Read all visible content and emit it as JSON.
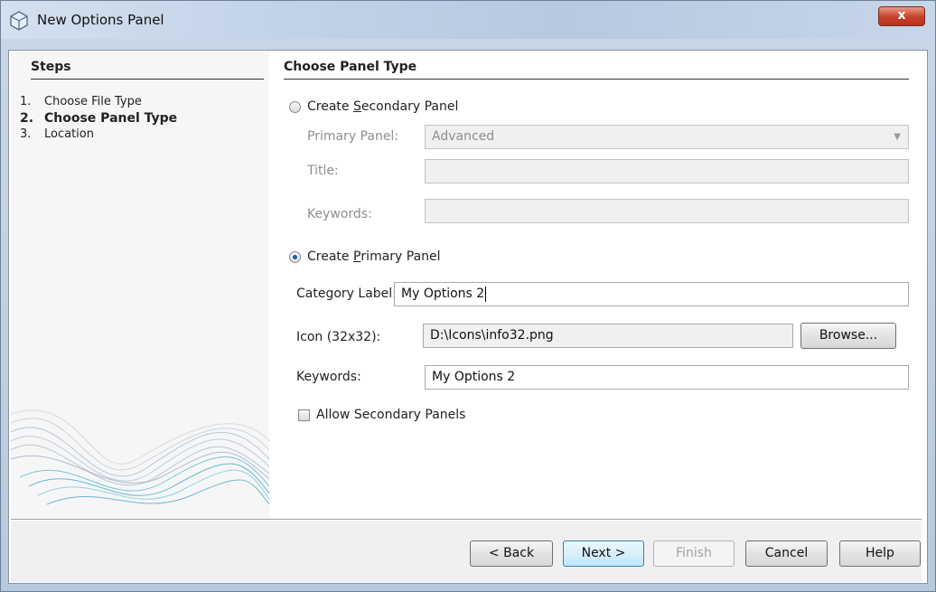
{
  "window": {
    "title": "New Options Panel",
    "close_glyph": "x"
  },
  "steps": {
    "heading": "Steps",
    "items": [
      {
        "num": "1.",
        "label": "Choose File Type"
      },
      {
        "num": "2.",
        "label": "Choose Panel Type"
      },
      {
        "num": "3.",
        "label": "Location"
      }
    ]
  },
  "main": {
    "heading": "Choose Panel Type",
    "secondary": {
      "radio_label_pre": "Create ",
      "radio_label_key": "S",
      "radio_label_post": "econdary Panel",
      "primary_panel_label": "Primary Panel:",
      "primary_panel_value": "Advanced",
      "title_label": "Title:",
      "title_value": "",
      "keywords_label": "Keywords:",
      "keywords_value": ""
    },
    "primary": {
      "radio_label_pre": "Create ",
      "radio_label_key": "P",
      "radio_label_post": "rimary Panel",
      "category_label": "Category Label:",
      "category_value": "My Options 2",
      "icon_label": "Icon (32x32):",
      "icon_value": "D:\\Icons\\info32.png",
      "browse_label": "Browse...",
      "keywords_label": "Keywords:",
      "keywords_value": "My Options 2",
      "allow_secondary_label": "Allow Secondary Panels"
    }
  },
  "footer": {
    "back": "< Back",
    "next": "Next >",
    "finish": "Finish",
    "cancel": "Cancel",
    "help": "Help"
  }
}
